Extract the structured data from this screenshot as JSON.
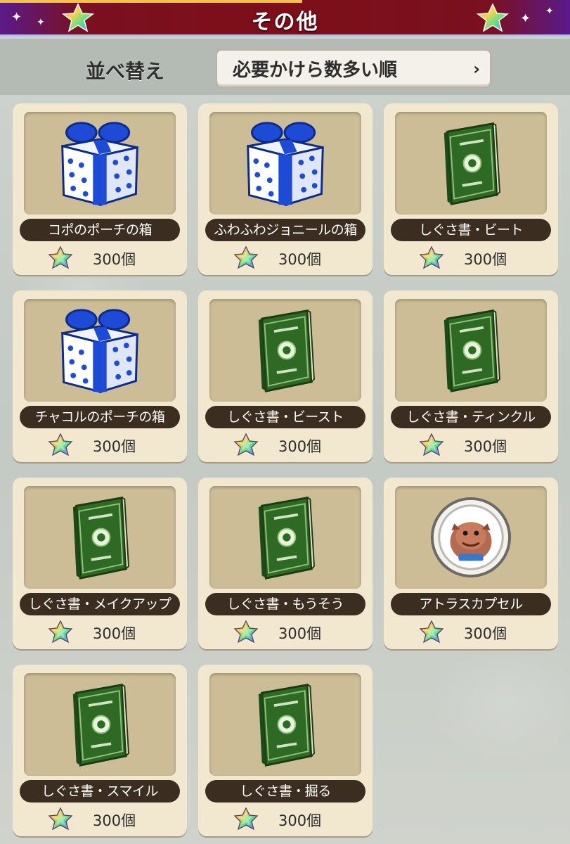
{
  "header": {
    "title": "その他"
  },
  "sort": {
    "label": "並べ替え",
    "value": "必要かけら数多い順",
    "chevron": "›"
  },
  "colors": {
    "header_red": "#7d0f18",
    "card_bg": "#f2e7cf",
    "image_bg": "#cdbd97",
    "name_bar": "#3b2e20",
    "progress": "#f1c542"
  },
  "items": [
    {
      "name": "コポのポーチの箱",
      "cost": "300個",
      "icon": "gift-box-icon"
    },
    {
      "name": "ふわふわジョニールの箱",
      "cost": "300個",
      "icon": "gift-box-icon"
    },
    {
      "name": "しぐさ書・ビート",
      "cost": "300個",
      "icon": "green-book-icon"
    },
    {
      "name": "チャコルのポーチの箱",
      "cost": "300個",
      "icon": "gift-box-icon"
    },
    {
      "name": "しぐさ書・ビースト",
      "cost": "300個",
      "icon": "green-book-icon"
    },
    {
      "name": "しぐさ書・ティンクル",
      "cost": "300個",
      "icon": "green-book-icon"
    },
    {
      "name": "しぐさ書・メイクアップ",
      "cost": "300個",
      "icon": "green-book-icon"
    },
    {
      "name": "しぐさ書・もうそう",
      "cost": "300個",
      "icon": "green-book-icon"
    },
    {
      "name": "アトラスカプセル",
      "cost": "300個",
      "icon": "monster-capsule-icon"
    },
    {
      "name": "しぐさ書・スマイル",
      "cost": "300個",
      "icon": "green-book-icon"
    },
    {
      "name": "しぐさ書・掘る",
      "cost": "300個",
      "icon": "green-book-icon"
    }
  ]
}
